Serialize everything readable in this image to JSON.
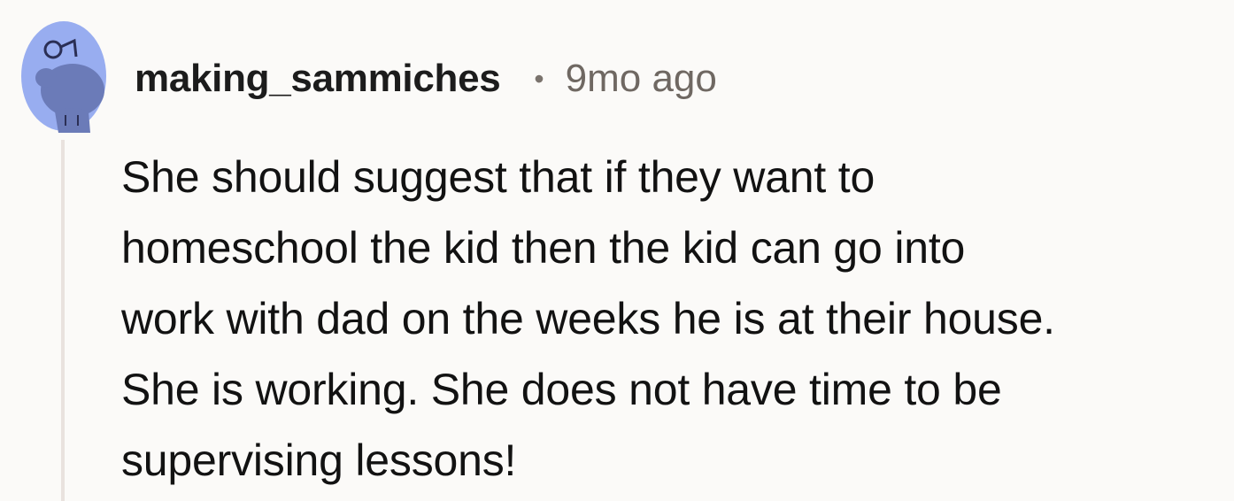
{
  "comment": {
    "author": "making_sammiches",
    "separator": "•",
    "timestamp": "9mo ago",
    "body_lines": [
      "She should suggest that if they want to",
      "homeschool the kid then the kid can go into",
      "work with dad on the weeks he is at their house.",
      "She is working. She does not have time to be",
      "supervising lessons!"
    ]
  },
  "colors": {
    "background": "#fbfaf8",
    "avatar_bg": "#98adf0",
    "avatar_figure": "#6b7bb8",
    "thread_line": "#e9e2de",
    "text": "#121212",
    "meta_text": "#6f6862"
  },
  "icons": {
    "avatar": "snoo-avatar-icon"
  }
}
